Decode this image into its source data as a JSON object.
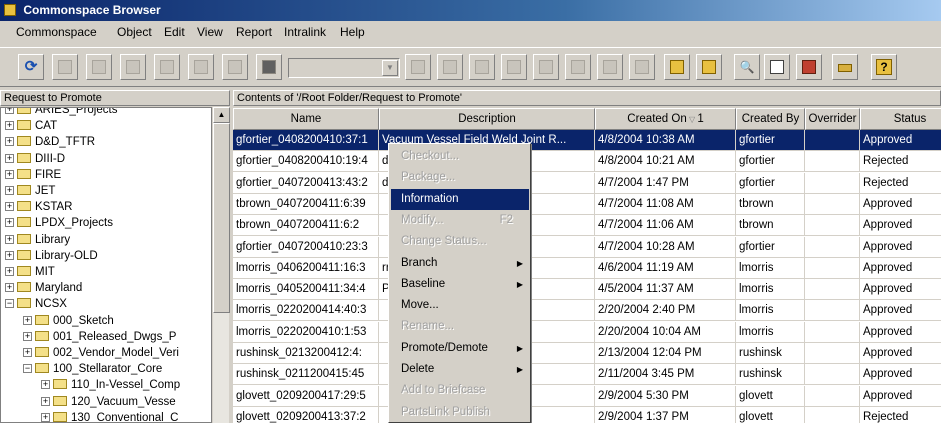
{
  "window": {
    "title": "Commonspace Browser"
  },
  "menubar": [
    "Commonspace",
    "Object",
    "Edit",
    "View",
    "Report",
    "Intralink",
    "Help"
  ],
  "left_panel": {
    "header": "Request to Promote",
    "tree": [
      {
        "label": "ARIES_Projects",
        "level": 0,
        "expanded": false
      },
      {
        "label": "CAT",
        "level": 0,
        "expanded": false
      },
      {
        "label": "D&D_TFTR",
        "level": 0,
        "expanded": false
      },
      {
        "label": "DIII-D",
        "level": 0,
        "expanded": false
      },
      {
        "label": "FIRE",
        "level": 0,
        "expanded": false
      },
      {
        "label": "JET",
        "level": 0,
        "expanded": false
      },
      {
        "label": "KSTAR",
        "level": 0,
        "expanded": false
      },
      {
        "label": "LPDX_Projects",
        "level": 0,
        "expanded": false
      },
      {
        "label": "Library",
        "level": 0,
        "expanded": false
      },
      {
        "label": "Library-OLD",
        "level": 0,
        "expanded": false
      },
      {
        "label": "MIT",
        "level": 0,
        "expanded": false
      },
      {
        "label": "Maryland",
        "level": 0,
        "expanded": false
      },
      {
        "label": "NCSX",
        "level": 0,
        "expanded": true
      },
      {
        "label": "000_Sketch",
        "level": 1,
        "expanded": false
      },
      {
        "label": "001_Released_Dwgs_P",
        "level": 1,
        "expanded": false
      },
      {
        "label": "002_Vendor_Model_Veri",
        "level": 1,
        "expanded": false
      },
      {
        "label": "100_Stellarator_Core",
        "level": 1,
        "expanded": true
      },
      {
        "label": "110_In-Vessel_Comp",
        "level": 2,
        "expanded": false
      },
      {
        "label": "120_Vacuum_Vesse",
        "level": 2,
        "expanded": false
      },
      {
        "label": "130_Conventional_C",
        "level": 2,
        "expanded": false
      }
    ]
  },
  "right_panel": {
    "header": "Contents of '/Root Folder/Request to Promote'",
    "columns": [
      "Name",
      "Description",
      "Created On",
      "Created By",
      "Overrider",
      "Status"
    ],
    "sort_indicator": "1",
    "rows": [
      {
        "name": "gfortier_0408200410:37:1",
        "desc": "Vacuum Vessel Field Weld Joint R...",
        "created_on": "4/8/2004 10:38 AM",
        "created_by": "gfortier",
        "overrider": "",
        "status": "Approved",
        "selected": true
      },
      {
        "name": "gfortier_0408200410:19:4",
        "desc": "d Joint R...",
        "created_on": "4/8/2004 10:21 AM",
        "created_by": "gfortier",
        "overrider": "",
        "status": "Rejected",
        "selected": false
      },
      {
        "name": "gfortier_0407200413:43:2",
        "desc": "d Joint R...",
        "created_on": "4/7/2004 1:47 PM",
        "created_by": "gfortier",
        "overrider": "",
        "status": "Rejected",
        "selected": false
      },
      {
        "name": "tbrown_0407200411:6:39",
        "desc": "",
        "created_on": "4/7/2004 11:08 AM",
        "created_by": "tbrown",
        "overrider": "",
        "status": "Approved",
        "selected": false
      },
      {
        "name": "tbrown_0407200411:6:2",
        "desc": "",
        "created_on": "4/7/2004 11:06 AM",
        "created_by": "tbrown",
        "overrider": "",
        "status": "Approved",
        "selected": false
      },
      {
        "name": "gfortier_0407200410:23:3",
        "desc": "",
        "created_on": "4/7/2004 10:28 AM",
        "created_by": "gfortier",
        "overrider": "",
        "status": "Approved",
        "selected": false
      },
      {
        "name": "lmorris_0406200411:16:3",
        "desc": "rry, but so...",
        "created_on": "4/6/2004 11:19 AM",
        "created_by": "lmorris",
        "overrider": "",
        "status": "Approved",
        "selected": false
      },
      {
        "name": "lmorris_0405200411:34:4",
        "desc": "PULATOR",
        "created_on": "4/5/2004 11:37 AM",
        "created_by": "lmorris",
        "overrider": "",
        "status": "Approved",
        "selected": false
      },
      {
        "name": "lmorris_0220200414:40:3",
        "desc": "",
        "created_on": "2/20/2004 2:40 PM",
        "created_by": "lmorris",
        "overrider": "",
        "status": "Approved",
        "selected": false
      },
      {
        "name": "lmorris_0220200410:1:53",
        "desc": "",
        "created_on": "2/20/2004 10:04 AM",
        "created_by": "lmorris",
        "overrider": "",
        "status": "Approved",
        "selected": false
      },
      {
        "name": "rushinsk_0213200412:4:",
        "desc": "",
        "created_on": "2/13/2004 12:04 PM",
        "created_by": "rushinsk",
        "overrider": "",
        "status": "Approved",
        "selected": false
      },
      {
        "name": "rushinsk_0211200415:45",
        "desc": "",
        "created_on": "2/11/2004 3:45 PM",
        "created_by": "rushinsk",
        "overrider": "",
        "status": "Approved",
        "selected": false
      },
      {
        "name": "glovett_0209200417:29:5",
        "desc": "",
        "created_on": "2/9/2004 5:30 PM",
        "created_by": "glovett",
        "overrider": "",
        "status": "Approved",
        "selected": false
      },
      {
        "name": "glovett_0209200413:37:2",
        "desc": "",
        "created_on": "2/9/2004 1:37 PM",
        "created_by": "glovett",
        "overrider": "",
        "status": "Rejected",
        "selected": false
      }
    ]
  },
  "context_menu": {
    "items": [
      {
        "label": "Checkout...",
        "disabled": true,
        "highlighted": false,
        "shortcut": "",
        "submenu": false
      },
      {
        "label": "Package...",
        "disabled": true,
        "highlighted": false,
        "shortcut": "",
        "submenu": false
      },
      {
        "label": "Information",
        "disabled": false,
        "highlighted": true,
        "shortcut": "",
        "submenu": false
      },
      {
        "label": "Modify...",
        "disabled": true,
        "highlighted": false,
        "shortcut": "F2",
        "submenu": false
      },
      {
        "label": "Change Status...",
        "disabled": true,
        "highlighted": false,
        "shortcut": "",
        "submenu": false
      },
      {
        "label": "Branch",
        "disabled": false,
        "highlighted": false,
        "shortcut": "",
        "submenu": true
      },
      {
        "label": "Baseline",
        "disabled": false,
        "highlighted": false,
        "shortcut": "",
        "submenu": true
      },
      {
        "label": "Move...",
        "disabled": false,
        "highlighted": false,
        "shortcut": "",
        "submenu": false
      },
      {
        "label": "Rename...",
        "disabled": true,
        "highlighted": false,
        "shortcut": "",
        "submenu": false
      },
      {
        "label": "Promote/Demote",
        "disabled": false,
        "highlighted": false,
        "shortcut": "",
        "submenu": true
      },
      {
        "label": "Delete",
        "disabled": false,
        "highlighted": false,
        "shortcut": "",
        "submenu": true
      },
      {
        "label": "Add to Briefcase",
        "disabled": true,
        "highlighted": false,
        "shortcut": "",
        "submenu": false
      },
      {
        "label": "PartsLink Publish",
        "disabled": true,
        "highlighted": false,
        "shortcut": "",
        "submenu": false
      }
    ]
  },
  "toolbar": {
    "icons": [
      "refresh-icon",
      "checkin-icon",
      "checkout-icon",
      "update-icon",
      "properties-icon",
      "move-icon",
      "delete-icon",
      "table-icon",
      "workspace-icon",
      "release-icon",
      "promote-icon",
      "compare-icon",
      "history-icon",
      "export-icon",
      "folder-icon",
      "search-icon",
      "report-icon",
      "notes-icon",
      "find-icon",
      "checklist-icon",
      "locate-icon",
      "key-icon",
      "help-icon"
    ],
    "help_symbol": "?"
  },
  "colors": {
    "selection": "#0a246a",
    "face": "#d4d0c8",
    "status_approved": "#000000",
    "status_rejected": "#000000"
  }
}
